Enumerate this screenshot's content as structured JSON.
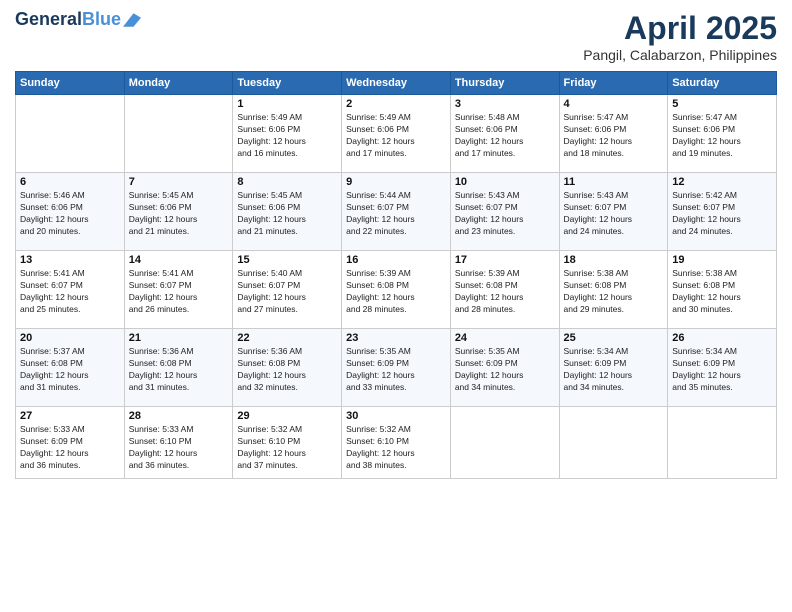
{
  "header": {
    "logo_line1": "General",
    "logo_line2": "Blue",
    "month": "April 2025",
    "location": "Pangil, Calabarzon, Philippines"
  },
  "weekdays": [
    "Sunday",
    "Monday",
    "Tuesday",
    "Wednesday",
    "Thursday",
    "Friday",
    "Saturday"
  ],
  "weeks": [
    [
      {
        "day": "",
        "info": ""
      },
      {
        "day": "",
        "info": ""
      },
      {
        "day": "1",
        "info": "Sunrise: 5:49 AM\nSunset: 6:06 PM\nDaylight: 12 hours\nand 16 minutes."
      },
      {
        "day": "2",
        "info": "Sunrise: 5:49 AM\nSunset: 6:06 PM\nDaylight: 12 hours\nand 17 minutes."
      },
      {
        "day": "3",
        "info": "Sunrise: 5:48 AM\nSunset: 6:06 PM\nDaylight: 12 hours\nand 17 minutes."
      },
      {
        "day": "4",
        "info": "Sunrise: 5:47 AM\nSunset: 6:06 PM\nDaylight: 12 hours\nand 18 minutes."
      },
      {
        "day": "5",
        "info": "Sunrise: 5:47 AM\nSunset: 6:06 PM\nDaylight: 12 hours\nand 19 minutes."
      }
    ],
    [
      {
        "day": "6",
        "info": "Sunrise: 5:46 AM\nSunset: 6:06 PM\nDaylight: 12 hours\nand 20 minutes."
      },
      {
        "day": "7",
        "info": "Sunrise: 5:45 AM\nSunset: 6:06 PM\nDaylight: 12 hours\nand 21 minutes."
      },
      {
        "day": "8",
        "info": "Sunrise: 5:45 AM\nSunset: 6:06 PM\nDaylight: 12 hours\nand 21 minutes."
      },
      {
        "day": "9",
        "info": "Sunrise: 5:44 AM\nSunset: 6:07 PM\nDaylight: 12 hours\nand 22 minutes."
      },
      {
        "day": "10",
        "info": "Sunrise: 5:43 AM\nSunset: 6:07 PM\nDaylight: 12 hours\nand 23 minutes."
      },
      {
        "day": "11",
        "info": "Sunrise: 5:43 AM\nSunset: 6:07 PM\nDaylight: 12 hours\nand 24 minutes."
      },
      {
        "day": "12",
        "info": "Sunrise: 5:42 AM\nSunset: 6:07 PM\nDaylight: 12 hours\nand 24 minutes."
      }
    ],
    [
      {
        "day": "13",
        "info": "Sunrise: 5:41 AM\nSunset: 6:07 PM\nDaylight: 12 hours\nand 25 minutes."
      },
      {
        "day": "14",
        "info": "Sunrise: 5:41 AM\nSunset: 6:07 PM\nDaylight: 12 hours\nand 26 minutes."
      },
      {
        "day": "15",
        "info": "Sunrise: 5:40 AM\nSunset: 6:07 PM\nDaylight: 12 hours\nand 27 minutes."
      },
      {
        "day": "16",
        "info": "Sunrise: 5:39 AM\nSunset: 6:08 PM\nDaylight: 12 hours\nand 28 minutes."
      },
      {
        "day": "17",
        "info": "Sunrise: 5:39 AM\nSunset: 6:08 PM\nDaylight: 12 hours\nand 28 minutes."
      },
      {
        "day": "18",
        "info": "Sunrise: 5:38 AM\nSunset: 6:08 PM\nDaylight: 12 hours\nand 29 minutes."
      },
      {
        "day": "19",
        "info": "Sunrise: 5:38 AM\nSunset: 6:08 PM\nDaylight: 12 hours\nand 30 minutes."
      }
    ],
    [
      {
        "day": "20",
        "info": "Sunrise: 5:37 AM\nSunset: 6:08 PM\nDaylight: 12 hours\nand 31 minutes."
      },
      {
        "day": "21",
        "info": "Sunrise: 5:36 AM\nSunset: 6:08 PM\nDaylight: 12 hours\nand 31 minutes."
      },
      {
        "day": "22",
        "info": "Sunrise: 5:36 AM\nSunset: 6:08 PM\nDaylight: 12 hours\nand 32 minutes."
      },
      {
        "day": "23",
        "info": "Sunrise: 5:35 AM\nSunset: 6:09 PM\nDaylight: 12 hours\nand 33 minutes."
      },
      {
        "day": "24",
        "info": "Sunrise: 5:35 AM\nSunset: 6:09 PM\nDaylight: 12 hours\nand 34 minutes."
      },
      {
        "day": "25",
        "info": "Sunrise: 5:34 AM\nSunset: 6:09 PM\nDaylight: 12 hours\nand 34 minutes."
      },
      {
        "day": "26",
        "info": "Sunrise: 5:34 AM\nSunset: 6:09 PM\nDaylight: 12 hours\nand 35 minutes."
      }
    ],
    [
      {
        "day": "27",
        "info": "Sunrise: 5:33 AM\nSunset: 6:09 PM\nDaylight: 12 hours\nand 36 minutes."
      },
      {
        "day": "28",
        "info": "Sunrise: 5:33 AM\nSunset: 6:10 PM\nDaylight: 12 hours\nand 36 minutes."
      },
      {
        "day": "29",
        "info": "Sunrise: 5:32 AM\nSunset: 6:10 PM\nDaylight: 12 hours\nand 37 minutes."
      },
      {
        "day": "30",
        "info": "Sunrise: 5:32 AM\nSunset: 6:10 PM\nDaylight: 12 hours\nand 38 minutes."
      },
      {
        "day": "",
        "info": ""
      },
      {
        "day": "",
        "info": ""
      },
      {
        "day": "",
        "info": ""
      }
    ]
  ]
}
